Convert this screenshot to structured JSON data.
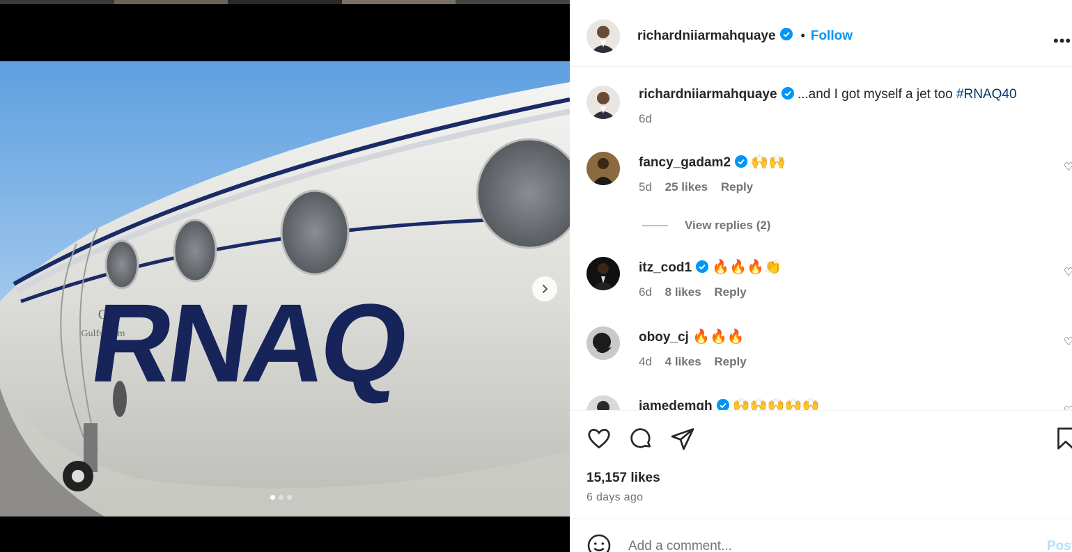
{
  "colors": {
    "accent": "#0095f6",
    "hashtag": "#00376b",
    "secondary_text": "#737373",
    "primary_text": "#262626",
    "verified": "#0095f6"
  },
  "post": {
    "author": "richardniiarmahquaye",
    "follow_label": "Follow",
    "separator": "•",
    "more_icon": "more-horizontal-icon",
    "media": {
      "slide_count": 3,
      "active_slide": 1,
      "tail_text": "RNAQ",
      "brand_text": "Gulfstream"
    },
    "caption": {
      "username": "richardniiarmahquaye",
      "text": " ...and I got myself a jet too ",
      "hashtag": "#RNAQ40",
      "time": "6d"
    },
    "comments": [
      {
        "username": "fancy_gadam2",
        "verified": true,
        "text": "🙌🙌",
        "time": "5d",
        "likes": "25 likes",
        "reply": "Reply"
      },
      {
        "username": "itz_cod1",
        "verified": true,
        "text": "🔥🔥🔥👏",
        "time": "6d",
        "likes": "8 likes",
        "reply": "Reply"
      },
      {
        "username": "oboy_cj",
        "verified": false,
        "text": "🔥🔥🔥",
        "time": "4d",
        "likes": "4 likes",
        "reply": "Reply"
      },
      {
        "username": "jamedemgh",
        "verified": true,
        "text": "🙌🙌🙌🙌🙌"
      }
    ],
    "view_replies": "View replies (2)",
    "likes": "15,157 likes",
    "time_ago": "6 days ago",
    "add_comment_placeholder": "Add a comment...",
    "post_label": "Post"
  }
}
